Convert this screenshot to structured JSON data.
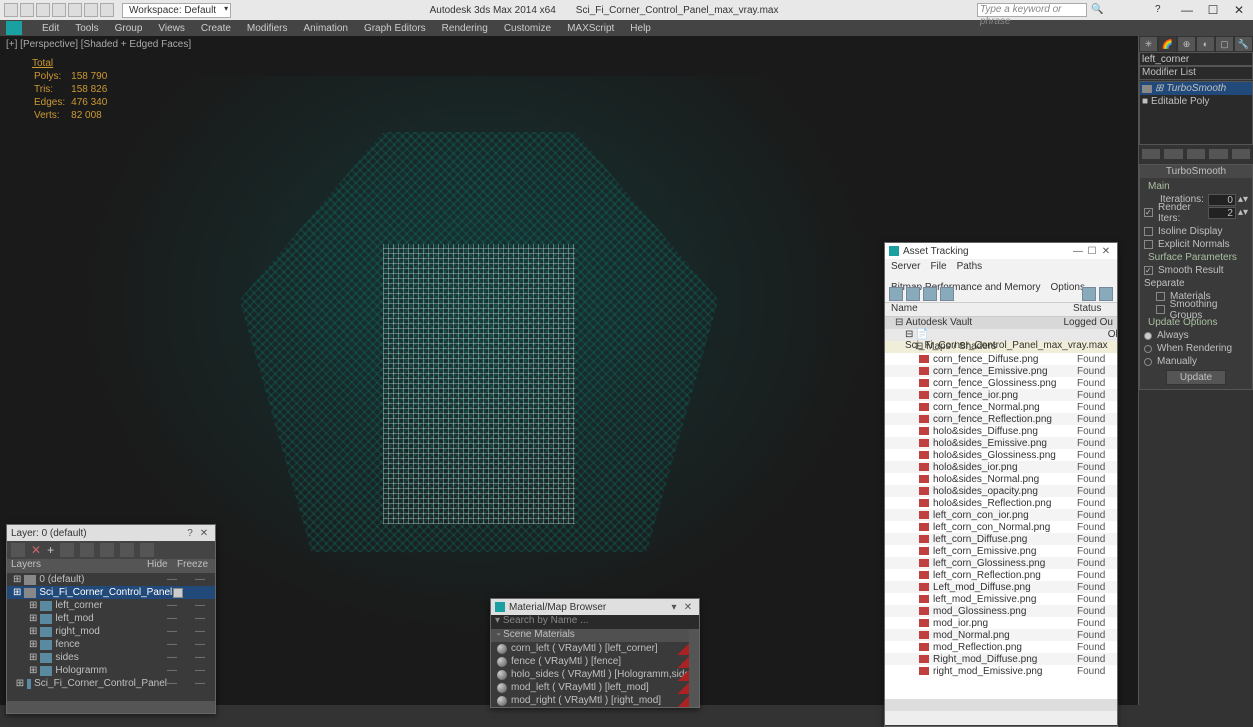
{
  "titlebar": {
    "workspace_label": "Workspace: Default",
    "app_title": "Autodesk 3ds Max  2014 x64",
    "filename": "Sci_Fi_Corner_Control_Panel_max_vray.max",
    "search_placeholder": "Type a keyword or phrase"
  },
  "menubar": [
    "Edit",
    "Tools",
    "Group",
    "Views",
    "Create",
    "Modifiers",
    "Animation",
    "Graph Editors",
    "Rendering",
    "Customize",
    "MAXScript",
    "Help"
  ],
  "viewport": {
    "label": "[+] [Perspective] [Shaded + Edged Faces]",
    "stats_title": "Total",
    "stats": [
      {
        "k": "Polys:",
        "v": "158 790"
      },
      {
        "k": "Tris:",
        "v": "158 826"
      },
      {
        "k": "Edges:",
        "v": "476 340"
      },
      {
        "k": "Verts:",
        "v": "82 008"
      }
    ]
  },
  "layer_panel": {
    "title": "Layer: 0 (default)",
    "cols": [
      "Layers",
      "Hide",
      "Freeze"
    ],
    "rows": [
      {
        "indent": 0,
        "icon": "layer",
        "name": "0 (default)",
        "type": "layer"
      },
      {
        "indent": 0,
        "icon": "layer",
        "name": "Sci_Fi_Corner_Control_Panel",
        "type": "layer",
        "selected": true,
        "checked": true
      },
      {
        "indent": 1,
        "icon": "obj",
        "name": "left_corner",
        "type": "obj"
      },
      {
        "indent": 1,
        "icon": "obj",
        "name": "left_mod",
        "type": "obj"
      },
      {
        "indent": 1,
        "icon": "obj",
        "name": "right_mod",
        "type": "obj"
      },
      {
        "indent": 1,
        "icon": "obj",
        "name": "fence",
        "type": "obj"
      },
      {
        "indent": 1,
        "icon": "obj",
        "name": "sides",
        "type": "obj"
      },
      {
        "indent": 1,
        "icon": "obj",
        "name": "Hologramm",
        "type": "obj"
      },
      {
        "indent": 1,
        "icon": "obj",
        "name": "Sci_Fi_Corner_Control_Panel",
        "type": "obj"
      }
    ]
  },
  "material_panel": {
    "title": "Material/Map Browser",
    "search": "Search by Name ...",
    "section": "- Scene Materials",
    "rows": [
      "corn_left  ( VRayMtl )  [left_corner]",
      "fence  ( VRayMtl )  [fence]",
      "holo_sides  ( VRayMtl )  [Hologramm,sides]",
      "mod_left  ( VRayMtl )  [left_mod]",
      "mod_right  ( VRayMtl )  [right_mod]"
    ]
  },
  "asset_panel": {
    "title": "Asset Tracking",
    "menu": [
      "Server",
      "File",
      "Paths",
      "Bitmap Performance and Memory",
      "Options"
    ],
    "cols": [
      "Name",
      "Status"
    ],
    "vault": "Autodesk Vault",
    "vault_status": "Logged Ou",
    "scene": "Sci_Fi_Corner_Control_Panel_max_vray.max",
    "scene_status": "Ok",
    "maps_label": "Maps / Shaders",
    "files": [
      "corn_fence_Diffuse.png",
      "corn_fence_Emissive.png",
      "corn_fence_Glossiness.png",
      "corn_fence_ior.png",
      "corn_fence_Normal.png",
      "corn_fence_Reflection.png",
      "holo&sides_Diffuse.png",
      "holo&sides_Emissive.png",
      "holo&sides_Glossiness.png",
      "holo&sides_ior.png",
      "holo&sides_Normal.png",
      "holo&sides_opacity.png",
      "holo&sides_Reflection.png",
      "left_corn_con_ior.png",
      "left_corn_con_Normal.png",
      "left_corn_Diffuse.png",
      "left_corn_Emissive.png",
      "left_corn_Glossiness.png",
      "left_corn_Reflection.png",
      "Left_mod_Diffuse.png",
      "left_mod_Emissive.png",
      "mod_Glossiness.png",
      "mod_ior.png",
      "mod_Normal.png",
      "mod_Reflection.png",
      "Right_mod_Diffuse.png",
      "right_mod_Emissive.png"
    ],
    "file_status": "Found"
  },
  "sidepanel": {
    "object_name": "left_corner",
    "mod_list_label": "Modifier List",
    "stack": [
      {
        "name": "TurboSmooth",
        "selected": true
      },
      {
        "name": "Editable Poly",
        "selected": false
      }
    ],
    "rollout_name": "TurboSmooth",
    "main_label": "Main",
    "iterations_label": "Iterations:",
    "iterations_value": "0",
    "render_iters_label": "Render Iters:",
    "render_iters_value": "2",
    "isoline_label": "Isoline Display",
    "explicit_label": "Explicit Normals",
    "surf_label": "Surface Parameters",
    "smooth_result_label": "Smooth Result",
    "separate_label": "Separate",
    "materials_label": "Materials",
    "smgroups_label": "Smoothing Groups",
    "update_label": "Update Options",
    "always_label": "Always",
    "when_rendering_label": "When Rendering",
    "manually_label": "Manually",
    "update_btn": "Update"
  }
}
